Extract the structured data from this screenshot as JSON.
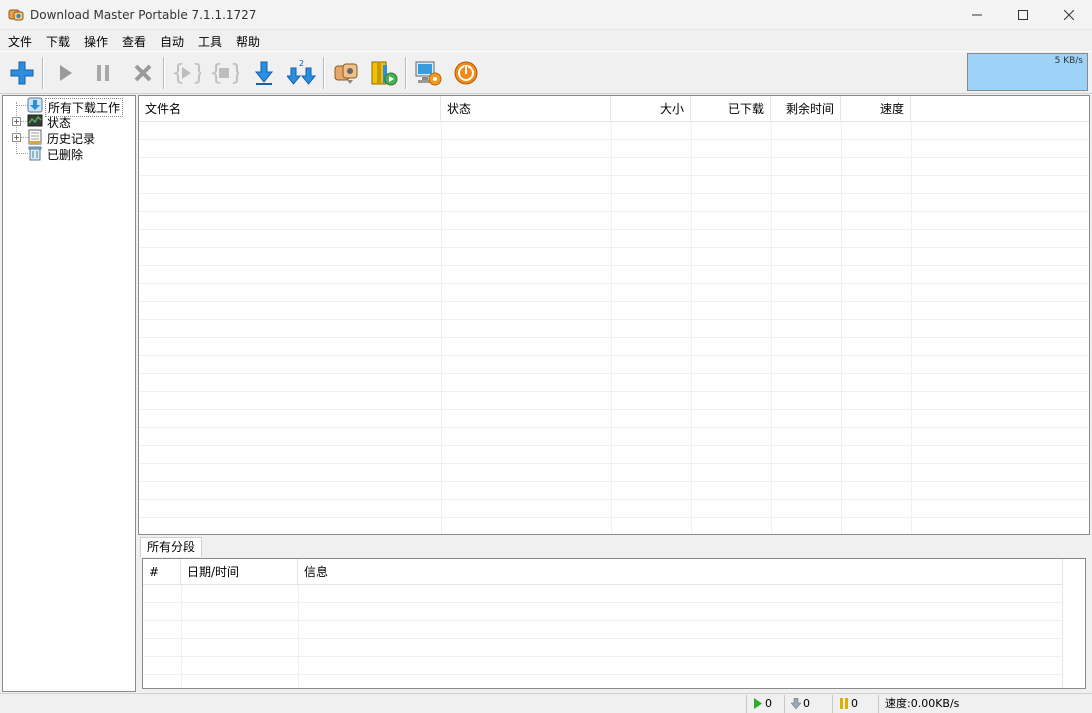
{
  "window": {
    "title": "Download Master Portable 7.1.1.1727",
    "icon": "download-master-icon"
  },
  "menu": [
    "文件",
    "下载",
    "操作",
    "查看",
    "自动",
    "工具",
    "帮助"
  ],
  "toolbar": {
    "buttons": [
      {
        "name": "add-download-icon",
        "enabled": true
      },
      {
        "name": "start-icon",
        "enabled": false
      },
      {
        "name": "pause-icon",
        "enabled": false
      },
      {
        "name": "delete-icon",
        "enabled": false
      },
      {
        "name": "start-all-icon",
        "enabled": false
      },
      {
        "name": "stop-all-icon",
        "enabled": false
      },
      {
        "name": "download-icon",
        "enabled": true
      },
      {
        "name": "download-2-icon",
        "enabled": true
      },
      {
        "name": "site-manager-icon",
        "enabled": true
      },
      {
        "name": "schedule-icon",
        "enabled": true
      },
      {
        "name": "monitor-icon",
        "enabled": true
      },
      {
        "name": "power-icon",
        "enabled": true
      }
    ],
    "download_2_badge": "2"
  },
  "speed_graph": {
    "label": "5 KB/s",
    "color": "#9dd3f7"
  },
  "tree": {
    "items": [
      {
        "label": "所有下载工作",
        "icon": "all-downloads-icon",
        "expandable": false,
        "selected": true
      },
      {
        "label": "状态",
        "icon": "status-icon",
        "expandable": true,
        "selected": false
      },
      {
        "label": "历史记录",
        "icon": "history-icon",
        "expandable": true,
        "selected": false
      },
      {
        "label": "已删除",
        "icon": "trash-icon",
        "expandable": false,
        "selected": false
      }
    ]
  },
  "download_list": {
    "columns": [
      "文件名",
      "状态",
      "大小",
      "已下载",
      "剩余时间",
      "速度"
    ],
    "rows": []
  },
  "log": {
    "tab_label": "所有分段",
    "columns": [
      "#",
      "日期/时间",
      "信息"
    ],
    "rows": []
  },
  "status_bar": {
    "active_count": "0",
    "queued_count": "0",
    "paused_count": "0",
    "speed_text": "速度:0.00KB/s"
  }
}
